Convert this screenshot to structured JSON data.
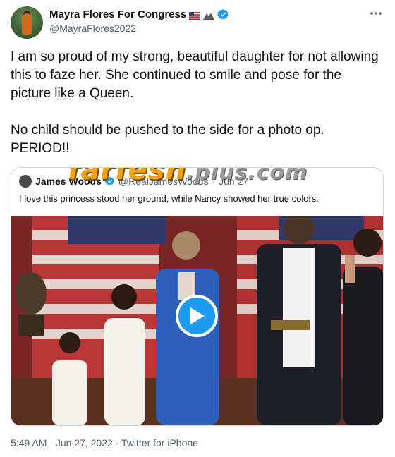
{
  "author": {
    "display_name": "Mayra Flores For Congress",
    "handle": "@MayraFlores2022",
    "badges": [
      "us-flag-icon",
      "mountain-icon",
      "verified-badge-icon"
    ]
  },
  "tweet": {
    "text": "I am so proud of my strong, beautiful daughter for not allowing this to faze her. She continued to smile and pose for the picture like a Queen.\n\nNo child should be pushed to the side for a photo op. PERIOD!!"
  },
  "quote": {
    "name": "James Woods",
    "handle": "@RealJamesWoods",
    "date": "Jun 27",
    "text": "I love this princess stood her ground, while Nancy showed her true colors."
  },
  "watermark": {
    "main": "farfesh",
    "suffix": ".plus.com"
  },
  "meta": {
    "time": "5:49 AM",
    "date": "Jun 27, 2022",
    "source": "Twitter for iPhone",
    "separator": " · "
  },
  "colors": {
    "accent": "#1d9bf0",
    "secondary_text": "#536471",
    "border": "#cfd9de"
  }
}
